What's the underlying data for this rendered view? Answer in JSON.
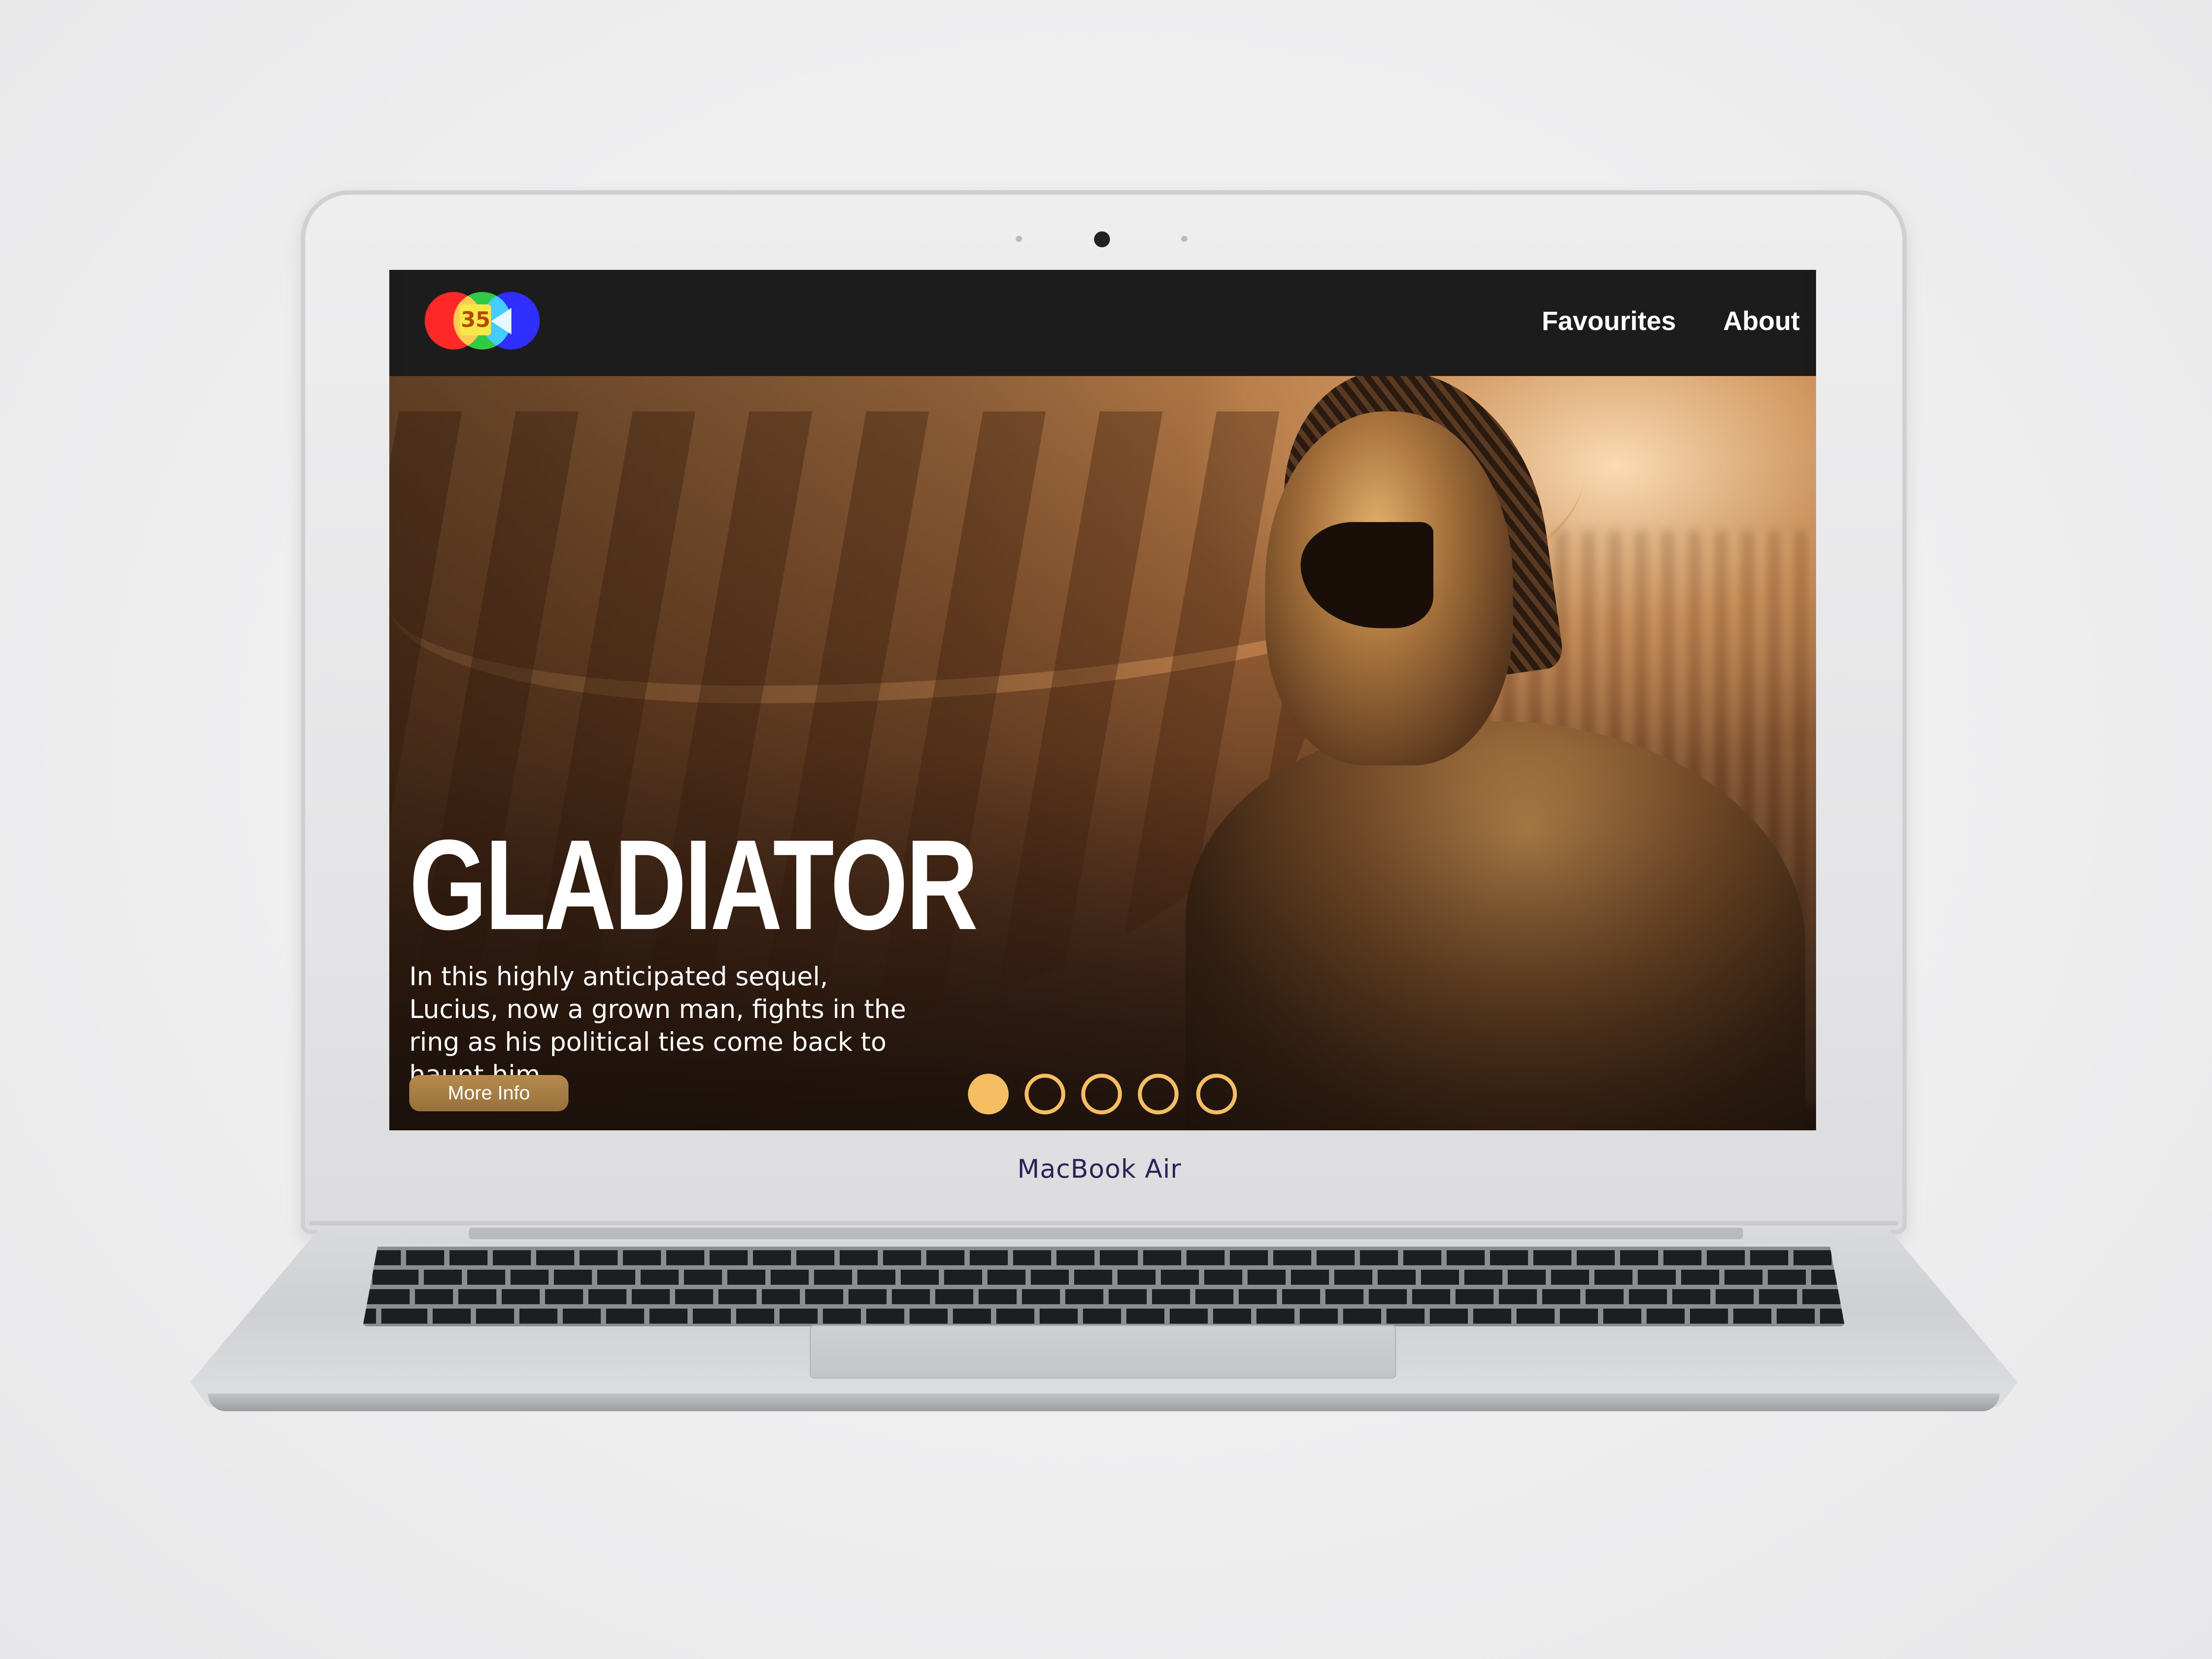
{
  "device": {
    "brand_label": "MacBook Air"
  },
  "site": {
    "logo": {
      "number": "35",
      "colors": [
        "#ff0d0d",
        "#18c330",
        "#1515ff"
      ]
    },
    "nav": {
      "links": [
        {
          "label": "Favourites"
        },
        {
          "label": "About"
        }
      ]
    },
    "hero": {
      "title": "GLADIATOR",
      "description": "In this highly anticipated sequel, Lucius, now a grown man, fights in the ring as his political ties come back to haunt him...",
      "button_label": "More Info",
      "carousel": {
        "total_slides": 5,
        "active_index": 0
      }
    },
    "colors": {
      "navbar_bg": "#1c1c1c",
      "accent": "#f5be63",
      "button_bg": "#a57d44"
    }
  }
}
